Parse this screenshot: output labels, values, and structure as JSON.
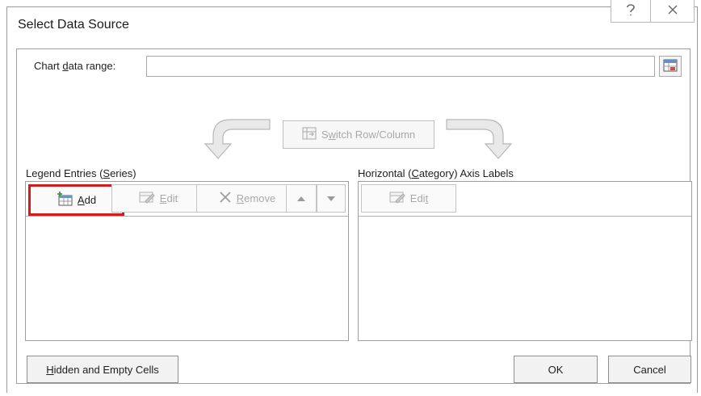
{
  "dialog": {
    "title": "Select Data Source",
    "help_icon": "help-icon",
    "close_icon": "close-icon"
  },
  "data_range": {
    "label_pre": "Chart ",
    "label_accel": "d",
    "label_post": "ata range:",
    "value": "",
    "collapse_icon": "range-select-icon"
  },
  "switch": {
    "pre": "S",
    "accel": "w",
    "post": "itch Row/Column",
    "enabled": false
  },
  "legend": {
    "label_pre": "Legend Entries (",
    "label_accel": "S",
    "label_post": "eries)",
    "add": {
      "accel": "A",
      "post": "dd",
      "enabled": true,
      "highlighted": true
    },
    "edit": {
      "accel": "E",
      "post": "dit",
      "enabled": false
    },
    "remove": {
      "accel": "R",
      "post": "emove",
      "enabled": false
    },
    "items": []
  },
  "axis": {
    "label_pre": "Horizontal (",
    "label_accel": "C",
    "label_post": "ategory) Axis Labels",
    "edit": {
      "pre": "Edi",
      "accel": "t",
      "enabled": false
    },
    "items": []
  },
  "footer": {
    "hidden_accel": "H",
    "hidden_post": "idden and Empty Cells",
    "ok": "OK",
    "cancel": "Cancel"
  },
  "colors": {
    "highlight": "#d01c1c",
    "disabled_text": "#a9a9a9",
    "border": "#9e9e9e"
  }
}
